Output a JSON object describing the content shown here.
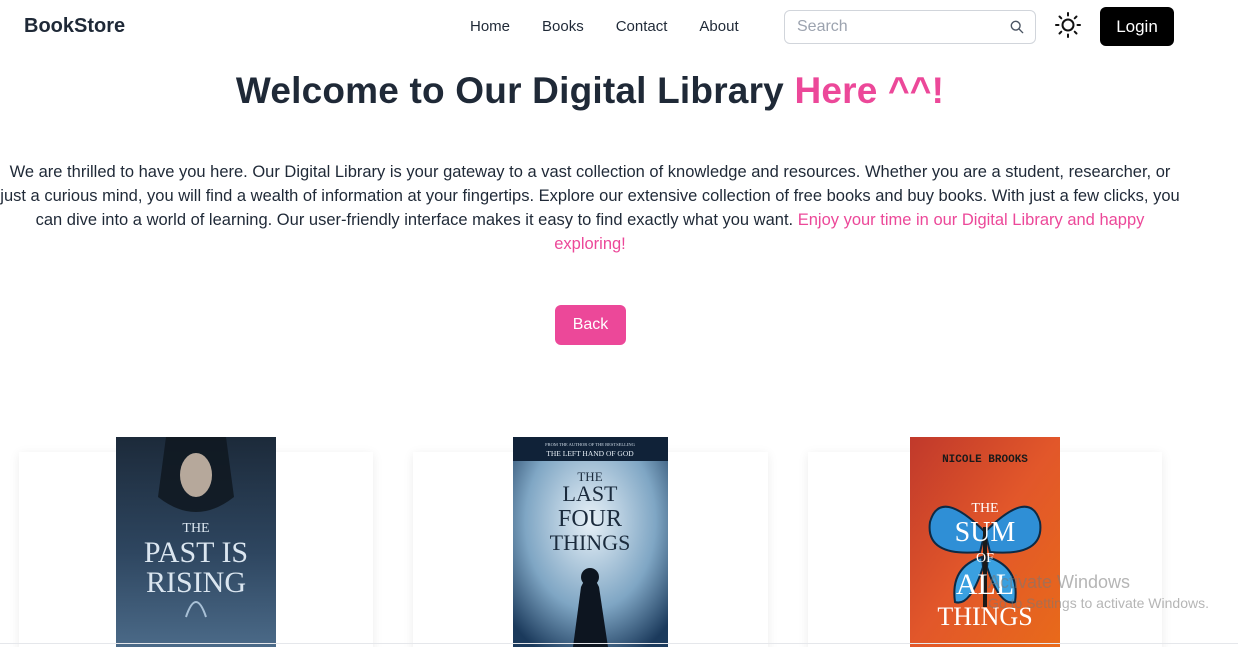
{
  "navbar": {
    "brand": "BookStore",
    "links": [
      "Home",
      "Books",
      "Contact",
      "About"
    ],
    "search_placeholder": "Search",
    "theme_icon": "sun-icon",
    "login_label": "Login"
  },
  "hero": {
    "title_main": "Welcome to Our Digital Library",
    "title_accent": "Here ^^!",
    "text_main": "We are thrilled to have you here. Our Digital Library is your gateway to a vast collection of knowledge and resources. Whether you are a student, researcher, or just a curious mind, you will find a wealth of information at your fingertips. Explore our extensive collection of free books and buy books. With just a few clicks, you can dive into a world of learning. Our user-friendly interface makes it easy to find exactly what you want.",
    "text_accent": "Enjoy your time in our Digital Library and happy exploring!",
    "back_label": "Back"
  },
  "books": [
    {
      "cover_lines": [
        "THE",
        "PAST IS",
        "RISING"
      ],
      "colors": {
        "top": "#1c2a3a",
        "bottom": "#4b6a88"
      }
    },
    {
      "cover_top": "FROM THE AUTHOR OF THE BESTSELLING",
      "cover_series": "THE LEFT HAND OF GOD",
      "cover_lines": [
        "THE",
        "LAST",
        "FOUR",
        "THINGS"
      ],
      "colors": {
        "top": "#1b3a5c",
        "bottom": "#c9dbe8"
      }
    },
    {
      "cover_author": "NICOLE BROOKS",
      "cover_lines": [
        "THE",
        "SUM",
        "OF",
        "ALL",
        "THINGS"
      ],
      "colors": {
        "top": "#c0392b",
        "bottom": "#e86a1a"
      }
    }
  ],
  "watermark": {
    "title": "Activate Windows",
    "subtitle": "Go to Settings to activate Windows."
  },
  "colors": {
    "accent": "#ec4899",
    "dark": "#1f2937",
    "login_bg": "#000000"
  }
}
